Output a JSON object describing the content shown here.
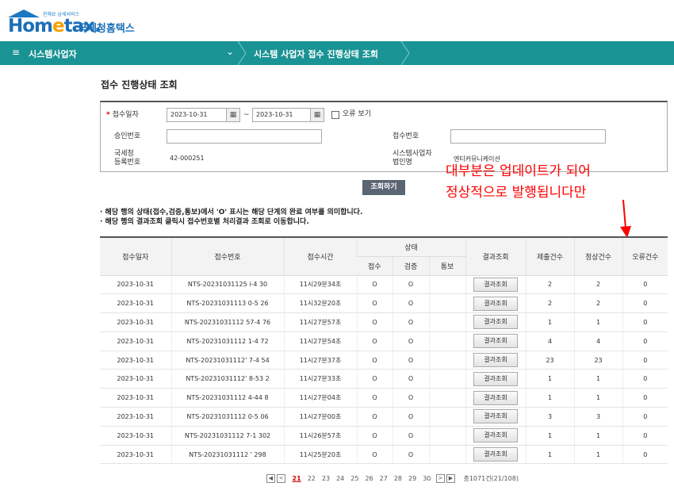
{
  "header": {
    "logo_tagline": "친해요 납세서비스",
    "logo_brand_a": "Hom",
    "logo_brand_e": "e",
    "logo_brand_b": "tax.",
    "logo_korean": "국세청홈택스"
  },
  "nav": {
    "menu_icon": "menu-icon",
    "crumb1": "시스템사업자",
    "crumb2": "시스템 사업자 접수 진행상태 조회"
  },
  "page_title": "접수 진행상태 조회",
  "form": {
    "date_label": "접수일자",
    "date_from": "2023-10-31",
    "date_to": "2023-10-31",
    "tilde": "~",
    "error_view_label": "오류 보기",
    "approval_label": "승인번호",
    "approval_value": "",
    "receipt_label": "접수번호",
    "receipt_value": "",
    "nts_reg_label_1": "국세청",
    "nts_reg_label_2": "등록번호",
    "nts_reg_value": "42-000251",
    "biz_name_label_1": "시스템사업자",
    "biz_name_label_2": "법인명",
    "biz_name_value": "엔티커뮤니케이션"
  },
  "search_button": "조회하기",
  "notes": [
    "· 해당 행의 상태(접수,검증,통보)에서 'O' 표시는 해당 단계의 완료 여부를 의미합니다.",
    "· 해당 행의 결과조회 클릭시 접수번호별 처리결과 조회로 이동합니다."
  ],
  "annotation": [
    "대부분은 업데이트가 되어",
    "정상적으로 발행됩니다만"
  ],
  "table": {
    "headers": {
      "date": "접수일자",
      "receipt_no": "접수번호",
      "time": "접수시간",
      "status": "상태",
      "st_receipt": "접수",
      "st_verify": "검증",
      "st_notify": "통보",
      "result": "결과조회",
      "submitted": "제출건수",
      "normal": "정상건수",
      "error": "오류건수"
    },
    "rows": [
      {
        "date": "2023-10-31",
        "no": "NTS-20231031125  i-4  30",
        "time": "11시29분34초",
        "r": "O",
        "v": "O",
        "n": "",
        "btn": "결과조회",
        "sub": "2",
        "ok": "2",
        "err": "0"
      },
      {
        "date": "2023-10-31",
        "no": "NTS-20231031113  0-5  26",
        "time": "11시32분20초",
        "r": "O",
        "v": "O",
        "n": "",
        "btn": "결과조회",
        "sub": "2",
        "ok": "2",
        "err": "0"
      },
      {
        "date": "2023-10-31",
        "no": "NTS-20231031112  57-4  76",
        "time": "11시27분57초",
        "r": "O",
        "v": "O",
        "n": "",
        "btn": "결과조회",
        "sub": "1",
        "ok": "1",
        "err": "0"
      },
      {
        "date": "2023-10-31",
        "no": "NTS-20231031112  1-4  72",
        "time": "11시27분54초",
        "r": "O",
        "v": "O",
        "n": "",
        "btn": "결과조회",
        "sub": "4",
        "ok": "4",
        "err": "0"
      },
      {
        "date": "2023-10-31",
        "no": "NTS-20231031112'  7-4  54",
        "time": "11시27분37초",
        "r": "O",
        "v": "O",
        "n": "",
        "btn": "결과조회",
        "sub": "23",
        "ok": "23",
        "err": "0"
      },
      {
        "date": "2023-10-31",
        "no": "NTS-20231031112'  8-53  2",
        "time": "11시27분33초",
        "r": "O",
        "v": "O",
        "n": "",
        "btn": "결과조회",
        "sub": "1",
        "ok": "1",
        "err": "0"
      },
      {
        "date": "2023-10-31",
        "no": "NTS-20231031112  4-44  8",
        "time": "11시27분04초",
        "r": "O",
        "v": "O",
        "n": "",
        "btn": "결과조회",
        "sub": "1",
        "ok": "1",
        "err": "0"
      },
      {
        "date": "2023-10-31",
        "no": "NTS-20231031112  0-5  06",
        "time": "11시27분00초",
        "r": "O",
        "v": "O",
        "n": "",
        "btn": "결과조회",
        "sub": "3",
        "ok": "3",
        "err": "0"
      },
      {
        "date": "2023-10-31",
        "no": "NTS-20231031112  7-1  302",
        "time": "11시26분57초",
        "r": "O",
        "v": "O",
        "n": "",
        "btn": "결과조회",
        "sub": "1",
        "ok": "1",
        "err": "0"
      },
      {
        "date": "2023-10-31",
        "no": "NTS-20231031112  '  298",
        "time": "11시25분20초",
        "r": "O",
        "v": "O",
        "n": "",
        "btn": "결과조회",
        "sub": "1",
        "ok": "1",
        "err": "0"
      }
    ]
  },
  "pager": {
    "first": "◀",
    "prev": "<",
    "pages": [
      "21",
      "22",
      "23",
      "24",
      "25",
      "26",
      "27",
      "28",
      "29",
      "30"
    ],
    "current": "21",
    "next": ">",
    "last": "▶",
    "total": "총1071건(21/108)"
  },
  "colors": {
    "nav_bg": "#1a9394",
    "brand_blue": "#1b6fb8",
    "brand_orange": "#f5a000",
    "annotation_red": "#ff0000"
  }
}
